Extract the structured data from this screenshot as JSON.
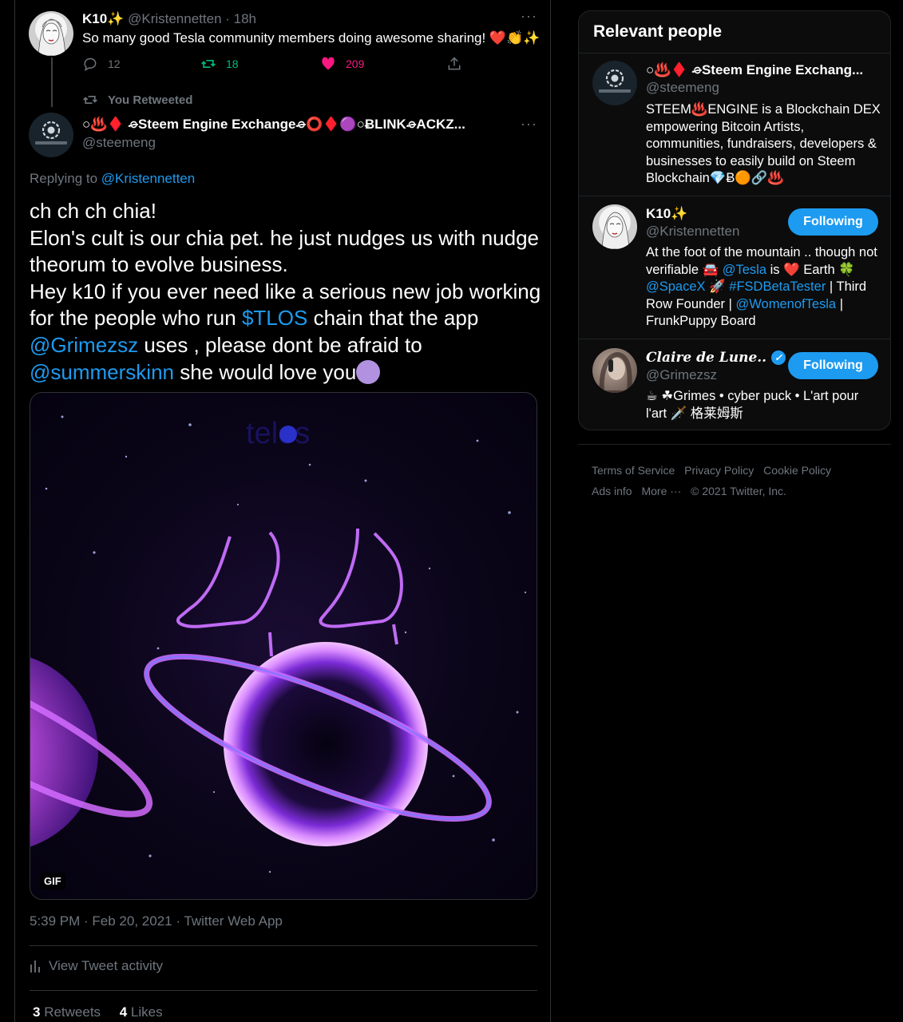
{
  "tweet_parent": {
    "name": "K10✨",
    "handle": "@Kristennetten",
    "time": "· 18h",
    "text": "So many good Tesla community members doing awesome sharing! ❤️👏✨",
    "replies": "12",
    "retweets": "18",
    "likes": "209"
  },
  "retweet_label": "You Retweeted",
  "tweet_main": {
    "name": "○♨️♦️ ⌮Steem Engine Exchange⌮⭕♦️🟣○ɃLINK⌮ACKZ...",
    "handle": "@steemeng",
    "replying_prefix": "Replying to ",
    "replying_to": "@Kristennetten",
    "line1": "ch ch ch chia!",
    "line2": "Elon's cult is our chia pet. he just nudges us with nudge theorum to evolve business.",
    "line3_a": "Hey k10 if you ever need like a serious new job working for the people who run ",
    "line3_link": "$TLOS",
    "line3_b": " chain that the app ",
    "line3_mention1": "@Grimezsz",
    "line3_c": " uses , please dont be afraid to ",
    "line3_mention2": "@summerskinn",
    "line3_d": " she would love you",
    "media_watermark": "telos",
    "gif_badge": "GIF",
    "timestamp": "5:39 PM · Feb 20, 2021 · Twitter Web App",
    "activity": "View Tweet activity",
    "retweets_count": "3",
    "retweets_label": " Retweets",
    "likes_count": "4",
    "likes_label": " Likes"
  },
  "relevant_people": {
    "title": "Relevant people",
    "people": [
      {
        "name": "○♨️♦️ ⌮Steem Engine Exchang...",
        "handle": "@steemeng",
        "bio": "STEEM♨️ENGINE is a Blockchain DEX empowering Bitcoin Artists, communities, fundraisers, developers & businesses to easily build on Steem Blockchain💎Ƀ🟠🔗♨️"
      },
      {
        "name": "K10✨",
        "handle": "@Kristennetten",
        "button": "Following",
        "bio_a": "At the foot of the mountain .. though not verifiable 🚘 ",
        "bio_m1": "@Tesla",
        "bio_b": " is ❤️ Earth 🍀 ",
        "bio_m2": "@SpaceX",
        "bio_c": " 🚀 ",
        "bio_m3": "#FSDBetaTester",
        "bio_d": " | Third Row Founder | ",
        "bio_m4": "@WomenofTesla",
        "bio_e": " | FrunkPuppy Board"
      },
      {
        "name": "Claire de Lune..",
        "handle": "@Grimezsz",
        "button": "Following",
        "bio": "☕ ☘Grimes • cyber puck • L'art pour l'art 🗡️ 格莱姆斯"
      }
    ]
  },
  "footer": {
    "links1": [
      "Terms of Service",
      "Privacy Policy",
      "Cookie Policy"
    ],
    "links2": [
      "Ads info",
      "More ···",
      "© 2021 Twitter, Inc."
    ]
  },
  "colors": {
    "accent": "#1d9bf0",
    "retweet_green": "#00ba7c",
    "like_pink": "#f91880",
    "background": "#000000"
  }
}
